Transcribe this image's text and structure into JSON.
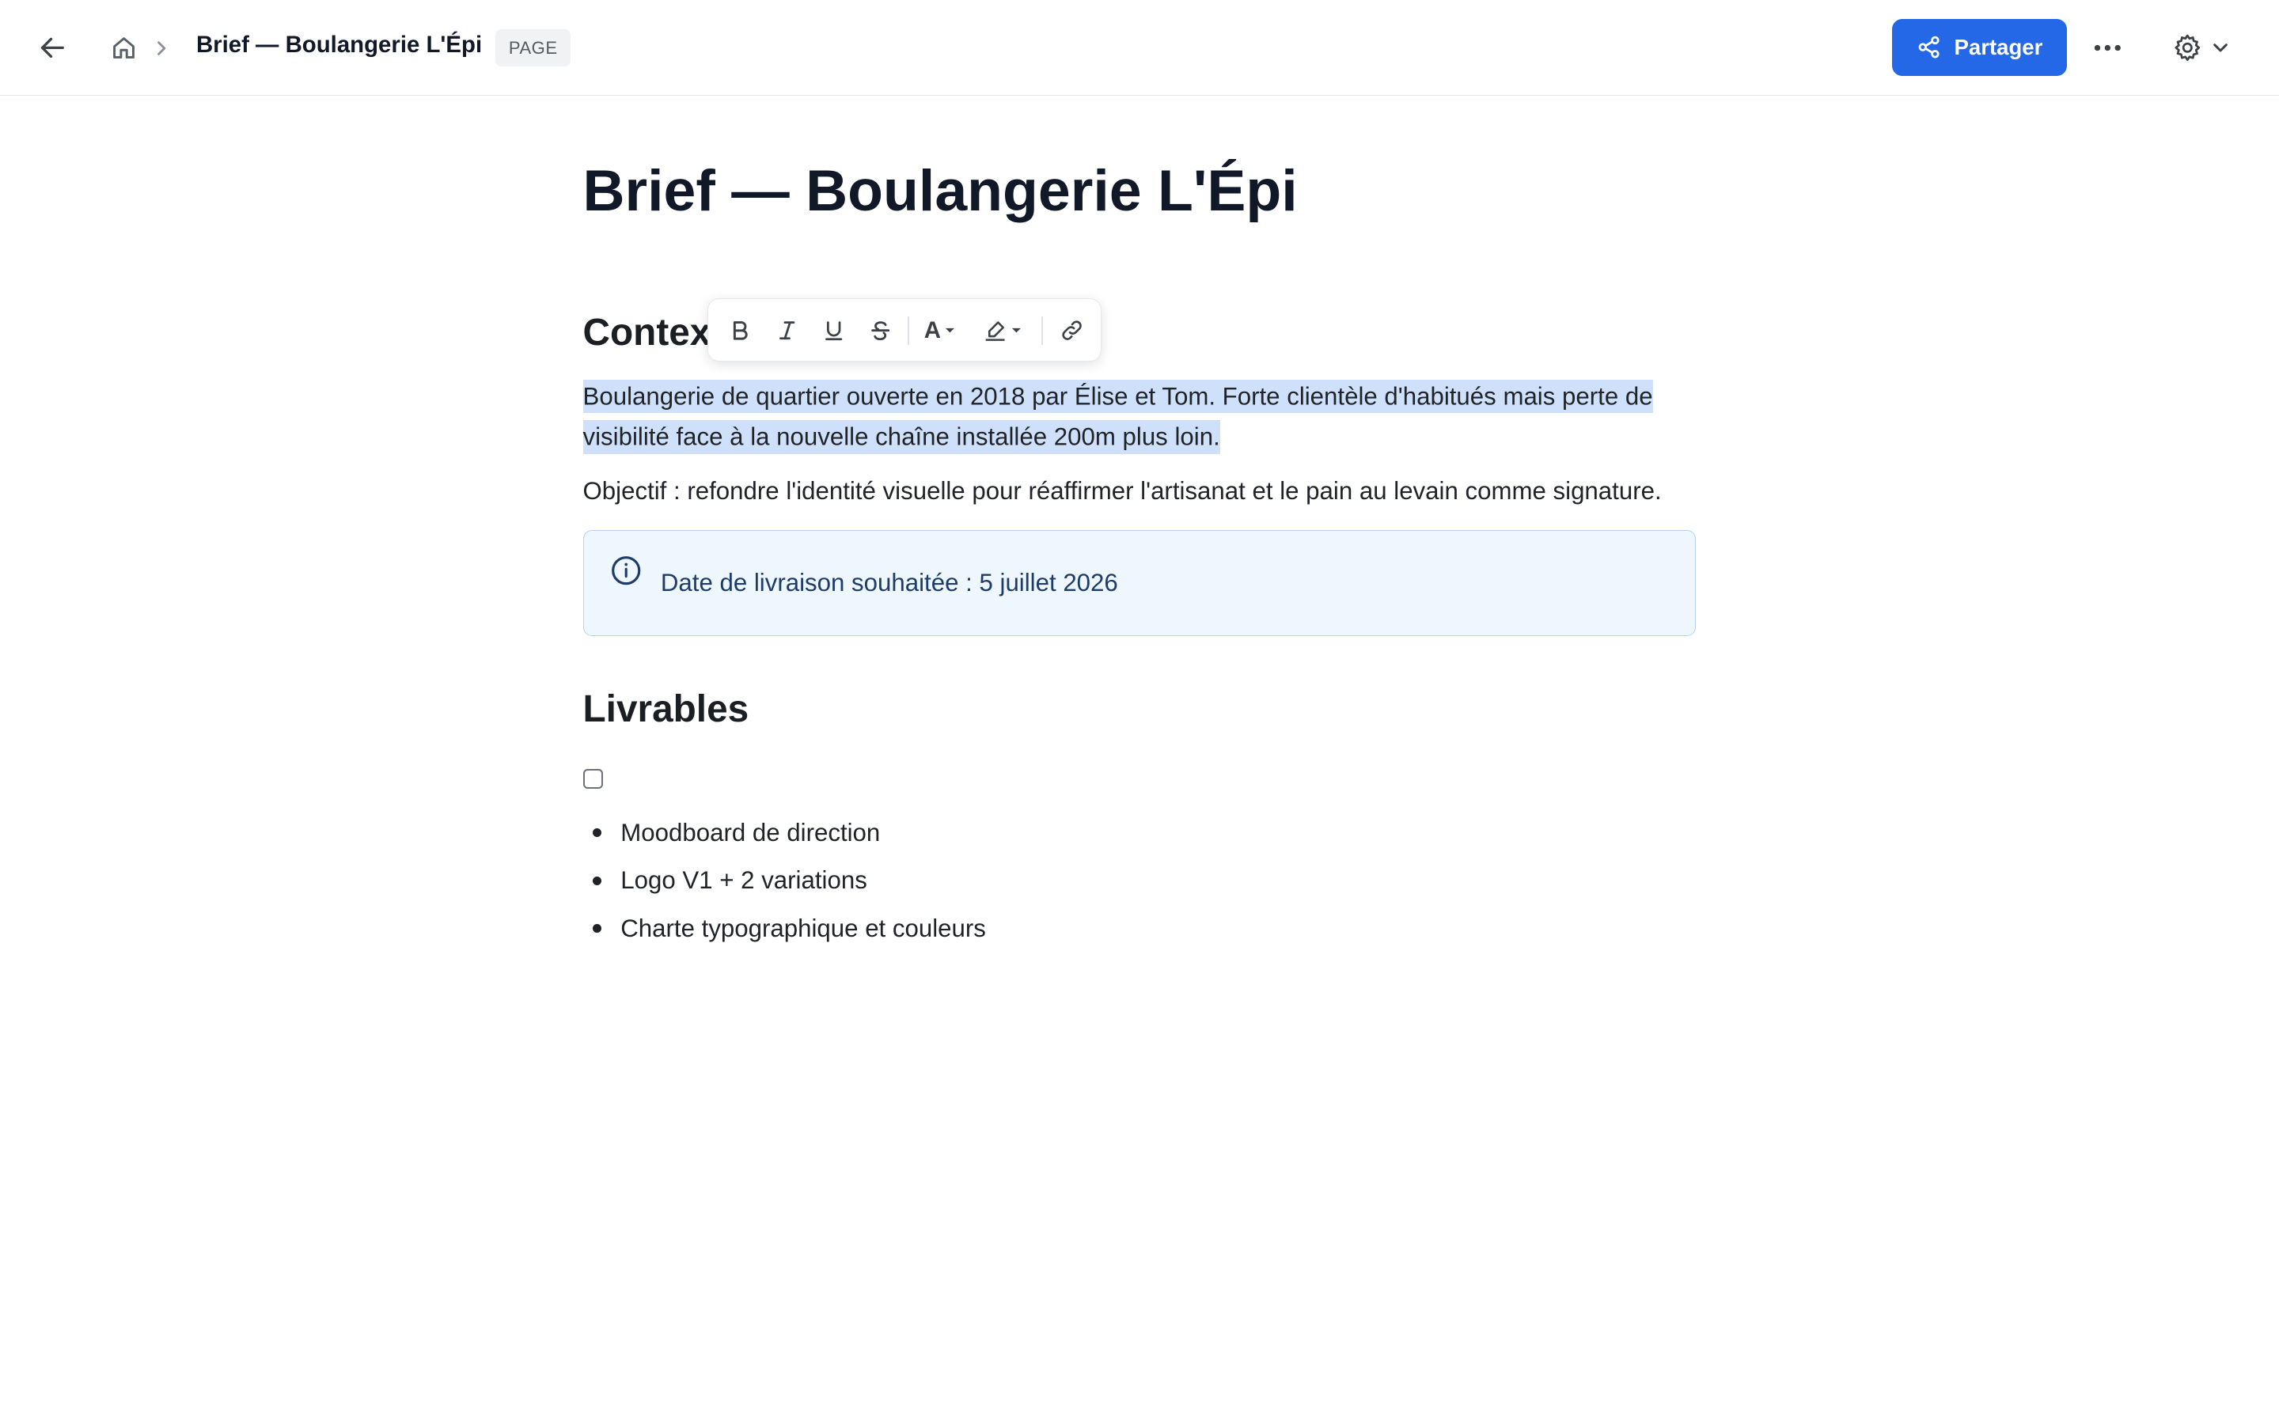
{
  "header": {
    "breadcrumb_title": "Brief — Boulangerie L'Épi",
    "page_badge": "PAGE",
    "share_label": "Partager",
    "accent_color": "#2468e8"
  },
  "icons": [
    "back-arrow-icon",
    "home-icon",
    "chevron-right-icon",
    "share-icon",
    "more-horizontal-icon",
    "gear-icon",
    "chevron-down-icon",
    "bold-icon",
    "italic-icon",
    "underline-icon",
    "strikethrough-icon",
    "text-color-icon",
    "highlighter-icon",
    "link-icon",
    "info-icon"
  ],
  "toolbar": {
    "text_color_glyph": "A"
  },
  "document": {
    "title": "Brief — Boulangerie L'Épi",
    "context_heading": "Contexte",
    "context_paragraph": "Boulangerie de quartier ouverte en 2018 par Élise et Tom. Forte clientèle d'habitués mais perte de visibilité face à la nouvelle chaîne installée 200m plus loin.",
    "objective_paragraph": "Objectif : refondre l'identité visuelle pour réaffirmer l'artisanat et le pain au levain comme signature.",
    "callout_text": "Date de livraison souhaitée : 5 juillet 2026",
    "deliverables_heading": "Livrables",
    "deliverables_checked": false,
    "deliverables": [
      "Moodboard de direction",
      "Logo V1 + 2 variations",
      "Charte typographique et couleurs"
    ]
  }
}
